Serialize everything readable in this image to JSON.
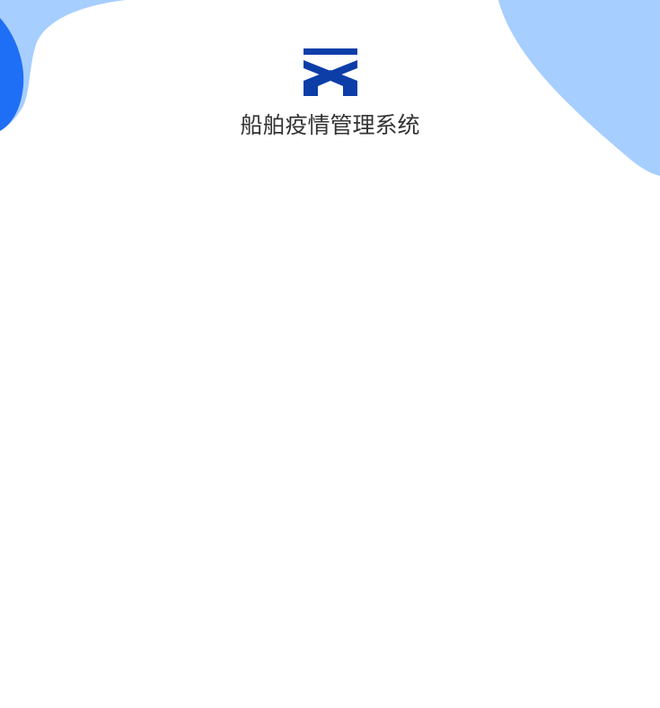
{
  "app": {
    "title": "船舶疫情管理系统",
    "logo_icon": "ship-chevron-logo-icon"
  },
  "theme": {
    "brand_color": "#0D3EA8",
    "blob_light": "#A6CEFF",
    "blob_dark": "#1E6FF5",
    "background": "#FFFFFF",
    "title_color": "#333333"
  }
}
